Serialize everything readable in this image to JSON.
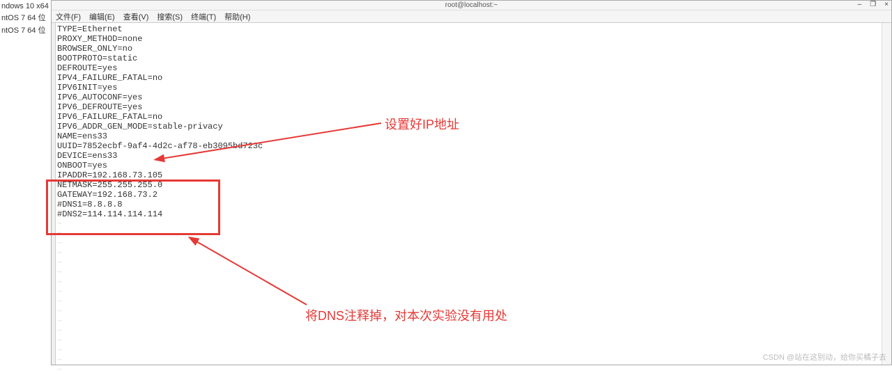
{
  "sidebar": {
    "items": [
      "ndows 10 x64",
      "ntOS 7 64 位",
      "ntOS 7 64 位"
    ]
  },
  "window": {
    "title": "root@localhost:~",
    "controls": {
      "min": "–",
      "max": "❐",
      "close": "×"
    }
  },
  "menu": {
    "file": "文件(F)",
    "edit": "编辑(E)",
    "view": "查看(V)",
    "search": "搜索(S)",
    "terminal": "终端(T)",
    "help": "帮助(H)"
  },
  "config_lines": [
    "TYPE=Ethernet",
    "PROXY_METHOD=none",
    "BROWSER_ONLY=no",
    "BOOTPROTO=static",
    "DEFROUTE=yes",
    "IPV4_FAILURE_FATAL=no",
    "IPV6INIT=yes",
    "IPV6_AUTOCONF=yes",
    "IPV6_DEFROUTE=yes",
    "IPV6_FAILURE_FATAL=no",
    "IPV6_ADDR_GEN_MODE=stable-privacy",
    "NAME=ens33",
    "UUID=7852ecbf-9af4-4d2c-af78-eb3095bd723c",
    "DEVICE=ens33",
    "ONBOOT=yes",
    "IPADDR=192.168.73.105",
    "NETMASK=255.255.255.0",
    "GATEWAY=192.168.73.2",
    "#DNS1=8.8.8.8",
    "#DNS2=114.114.114.114"
  ],
  "annotations": {
    "ip_label": "设置好IP地址",
    "dns_label": "将DNS注释掉，对本次实验没有用处"
  },
  "watermark": "CSDN @站在这别动，给你买橘子去"
}
